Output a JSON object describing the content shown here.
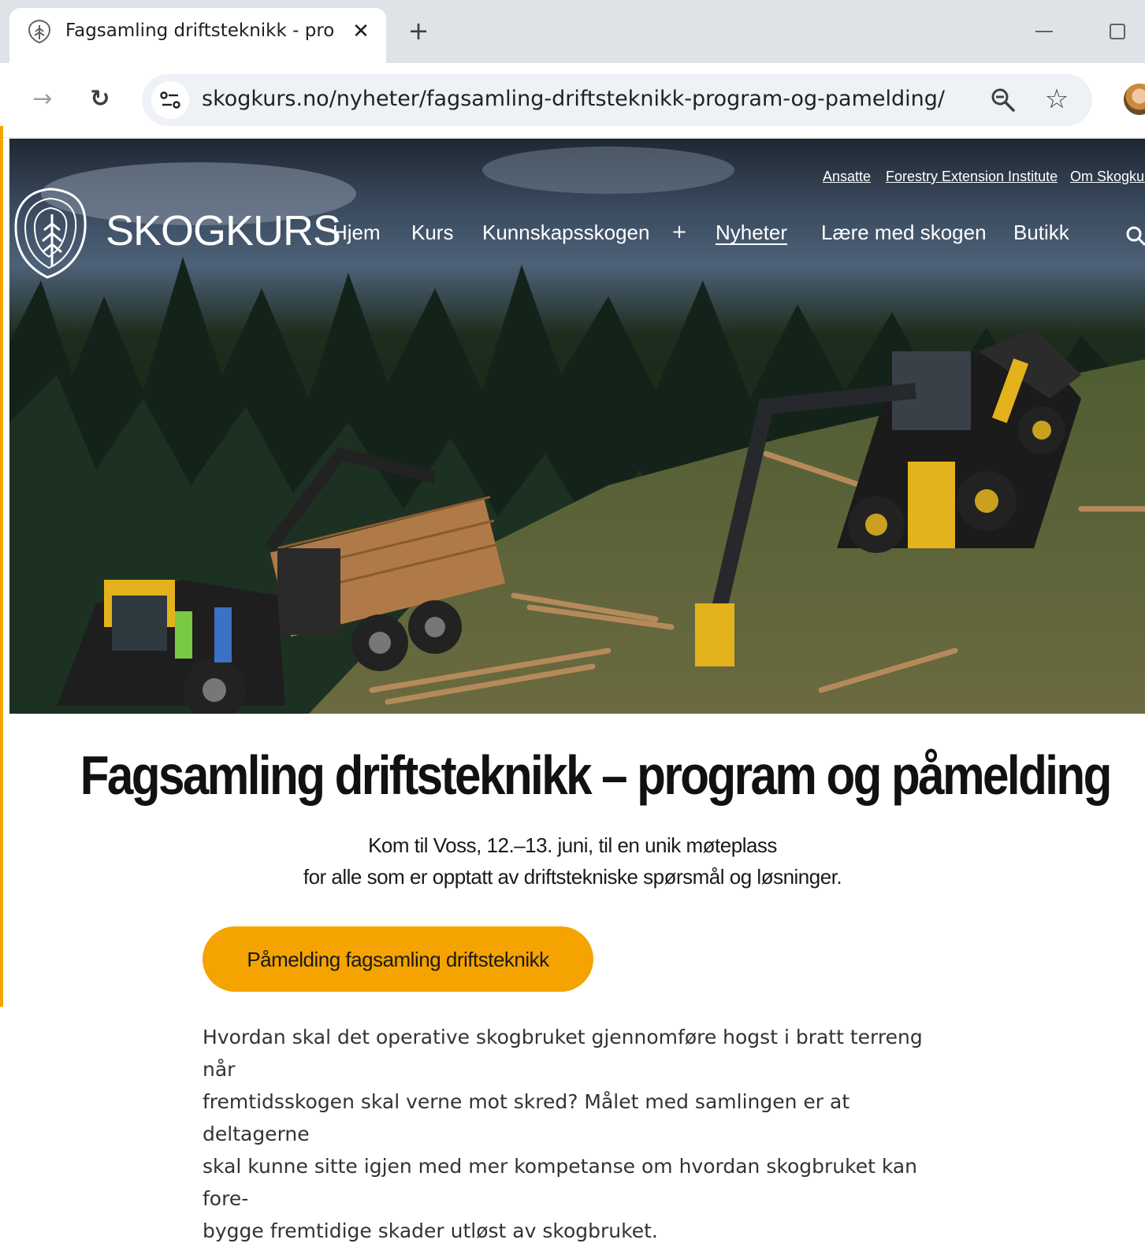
{
  "browser": {
    "tab_title": "Fagsamling driftsteknikk - program og påmelding",
    "close_symbol": "✕",
    "new_tab_symbol": "+",
    "url": "skogkurs.no/nyheter/fagsamling-driftsteknikk-program-og-pamelding/",
    "forward_symbol": "→",
    "reload_symbol": "↻",
    "star_symbol": "☆"
  },
  "site": {
    "brand": "SKOGKURS",
    "utility_nav": [
      "Ansatte",
      "Forestry Extension Institute",
      "Om Skogkurs"
    ],
    "main_nav": [
      {
        "label": "Hjem"
      },
      {
        "label": "Kurs"
      },
      {
        "label": "Kunnskapsskogen"
      },
      {
        "label": "Nyheter",
        "active": true
      },
      {
        "label": "Lære med skogen"
      },
      {
        "label": "Butikk"
      }
    ],
    "plus_symbol": "+"
  },
  "article": {
    "title": "Fagsamling driftsteknikk – program og påmelding",
    "lead_line_1": "Kom til Voss, 12.–13. juni, til en unik møteplass",
    "lead_line_2": "for alle som er opptatt av driftstekniske spørsmål og løsninger.",
    "cta_label": "Påmelding fagsamling driftsteknikk",
    "body_lines": [
      "Hvordan skal det operative skogbruket gjennomføre hogst i bratt terreng når",
      "fremtidsskogen skal verne mot skred? Målet med samlingen er at deltagerne",
      "skal kunne sitte igjen med mer kompetanse om hvordan skogbruket kan fore-",
      "bygge fremtidige skader utløst av skogbruket."
    ]
  },
  "colors": {
    "accent": "#f5a300",
    "title_text": "#111111",
    "body_text": "#333333"
  }
}
